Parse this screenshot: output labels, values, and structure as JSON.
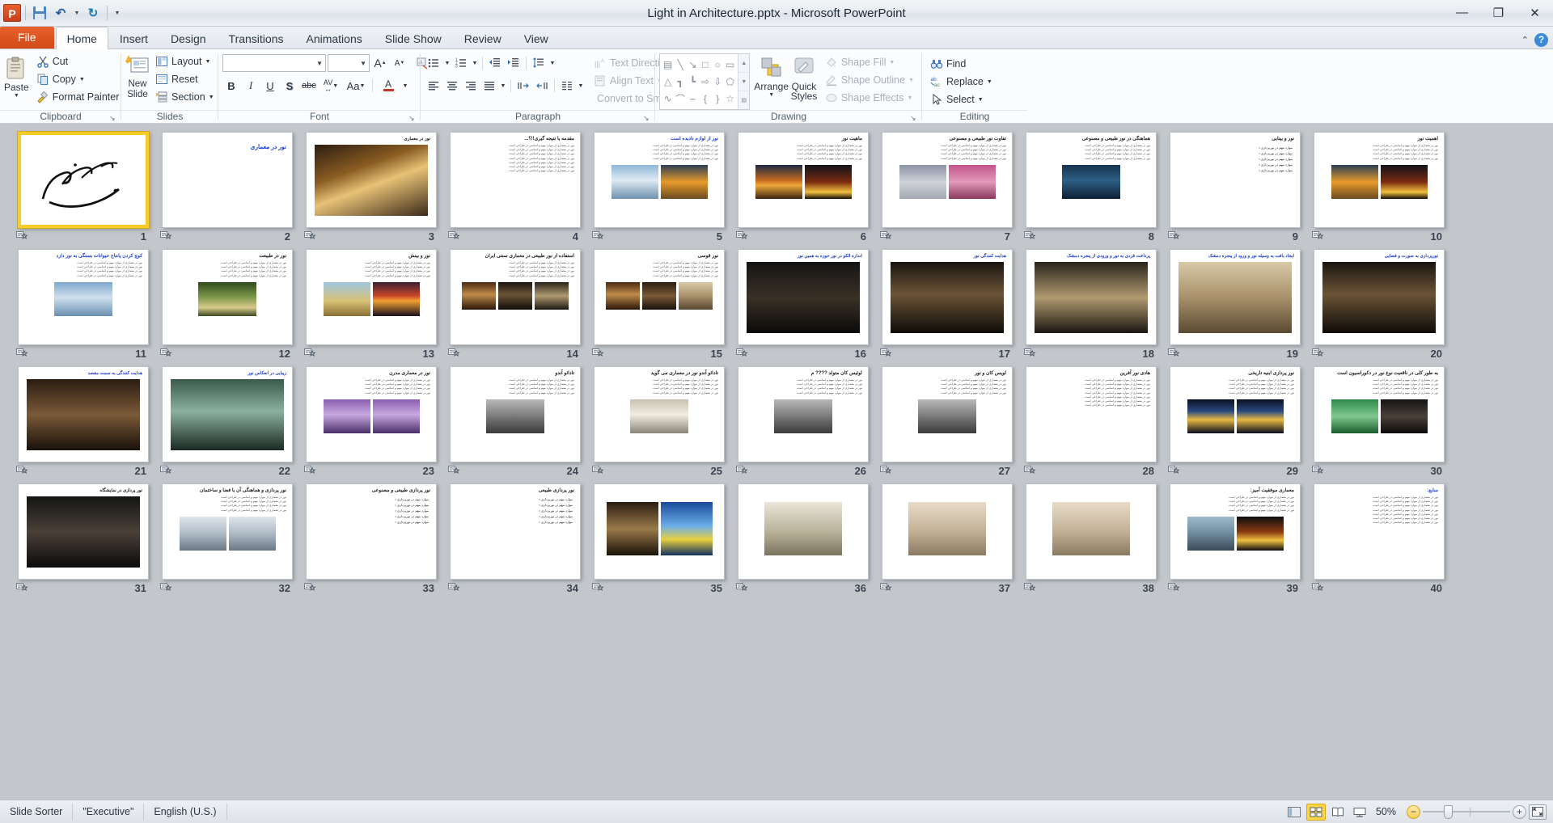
{
  "window": {
    "title": "Light in Architecture.pptx  -  Microsoft PowerPoint",
    "minimize": "—",
    "restore": "❐",
    "close": "✕"
  },
  "qat": {
    "logo": "P",
    "save": "save-icon",
    "undo": "↶",
    "redo": "↻",
    "customize": "≡"
  },
  "tabs": [
    {
      "label": "File",
      "active": false,
      "file": true
    },
    {
      "label": "Home",
      "active": true
    },
    {
      "label": "Insert",
      "active": false
    },
    {
      "label": "Design",
      "active": false
    },
    {
      "label": "Transitions",
      "active": false
    },
    {
      "label": "Animations",
      "active": false
    },
    {
      "label": "Slide Show",
      "active": false
    },
    {
      "label": "Review",
      "active": false
    },
    {
      "label": "View",
      "active": false
    }
  ],
  "help": {
    "minimize_ribbon": "⌃",
    "help": "?"
  },
  "ribbon": {
    "clipboard": {
      "label": "Clipboard",
      "paste": "Paste",
      "cut": "Cut",
      "copy": "Copy",
      "format_painter": "Format Painter",
      "launcher": "↘"
    },
    "slides": {
      "label": "Slides",
      "new_slide": "New\nSlide",
      "new_slide_l1": "New",
      "new_slide_l2": "Slide",
      "layout": "Layout",
      "reset": "Reset",
      "section": "Section"
    },
    "font": {
      "label": "Font",
      "font_name": "",
      "font_size": "",
      "grow": "A",
      "shrink": "A",
      "clear_formatting": "clear-formatting-icon",
      "bold": "B",
      "italic": "I",
      "underline": "U",
      "shadow": "S",
      "strikethrough": "abc",
      "character_spacing": "AV",
      "change_case": "Aa",
      "font_color": "A",
      "launcher": "↘"
    },
    "paragraph": {
      "label": "Paragraph",
      "text_direction": "Text Direction",
      "align_text": "Align Text",
      "convert_to_smartart": "Convert to SmartArt",
      "launcher": "↘"
    },
    "drawing": {
      "label": "Drawing",
      "arrange": "Arrange",
      "quick_styles_l1": "Quick",
      "quick_styles_l2": "Styles",
      "shape_fill": "Shape Fill",
      "shape_outline": "Shape Outline",
      "shape_effects": "Shape Effects",
      "launcher": "↘",
      "shapes": [
        "▤",
        "╲",
        "↘",
        "□",
        "○",
        "▭",
        "△",
        "┓",
        "┗",
        "⇨",
        "⇩",
        "⬠",
        "∿",
        "⌒",
        "⌢",
        "{",
        "}",
        "☆"
      ]
    },
    "editing": {
      "label": "Editing",
      "find": "Find",
      "replace": "Replace",
      "select": "Select"
    }
  },
  "slides": [
    {
      "n": 1,
      "selected": true,
      "type": "calligraphy",
      "title": "",
      "title_color": "black"
    },
    {
      "n": 2,
      "selected": false,
      "type": "title-only",
      "title": "نور در معماری",
      "title_color": "blue"
    },
    {
      "n": 3,
      "selected": false,
      "type": "full-image",
      "title": "نور در معماری",
      "title_color": "white",
      "img": "g-louvre"
    },
    {
      "n": 4,
      "selected": false,
      "type": "text-heavy",
      "title": "مقدمه یا نتیجه گیری!!؟...",
      "title_color": "black"
    },
    {
      "n": 5,
      "selected": false,
      "type": "text-images",
      "title": "نور از لوازم نادیده است",
      "title_color": "blue",
      "imgs": [
        "g-seadawn",
        "g-sunsea"
      ]
    },
    {
      "n": 6,
      "selected": false,
      "type": "text-images",
      "title": "ماهیت نور",
      "title_color": "black",
      "imgs": [
        "g-sunset",
        "g-fire"
      ]
    },
    {
      "n": 7,
      "selected": false,
      "type": "text-images",
      "title": "تفاوت نور طبیعی و مصنوعی",
      "title_color": "black",
      "imgs": [
        "g-mosque",
        "g-pink"
      ]
    },
    {
      "n": 8,
      "selected": false,
      "type": "text-images",
      "title": "هماهنگی در نور طبیعی و مصنوعی",
      "title_color": "black",
      "imgs": [
        "g-bluewater"
      ]
    },
    {
      "n": 9,
      "selected": false,
      "type": "bullets",
      "title": "نور و بینایی",
      "title_color": "black"
    },
    {
      "n": 10,
      "selected": false,
      "type": "text-images",
      "title": "اهمیت نور",
      "title_color": "black",
      "imgs": [
        "g-sunsea",
        "g-fire"
      ]
    },
    {
      "n": 11,
      "selected": false,
      "type": "text-images",
      "title": "کوچ کردن پانتاج حیوانات بستگی به نور دارد",
      "title_color": "blue",
      "imgs": [
        "g-birds"
      ]
    },
    {
      "n": 12,
      "selected": false,
      "type": "text-images",
      "title": "نور در طبیعت",
      "title_color": "black",
      "imgs": [
        "g-forest"
      ]
    },
    {
      "n": 13,
      "selected": false,
      "type": "text-images",
      "title": "نور و بینش",
      "title_color": "black",
      "imgs": [
        "g-pyramid",
        "g-lighthouse"
      ]
    },
    {
      "n": 14,
      "selected": false,
      "type": "text-images",
      "title": "استفاده از نور طبیعی در معماری سنتی ایران",
      "title_color": "black",
      "imgs": [
        "g-vault",
        "g-arch",
        "g-colonnade"
      ]
    },
    {
      "n": 15,
      "selected": false,
      "type": "text-images",
      "title": "نور قوسی",
      "title_color": "black",
      "imgs": [
        "g-vault",
        "g-brick",
        "g-latticed"
      ]
    },
    {
      "n": 16,
      "selected": false,
      "type": "full-image",
      "title": "اندازه الکو در نور حوزه به همین نور",
      "title_color": "blue",
      "img": "g-darkcorr"
    },
    {
      "n": 17,
      "selected": false,
      "type": "full-image",
      "title": "هدایت کنندگی نور",
      "title_color": "blue",
      "img": "g-arch"
    },
    {
      "n": 18,
      "selected": false,
      "type": "full-image",
      "title": "پرداخت فردی به نور و ورودی از پنجره دمشک",
      "title_color": "blue",
      "img": "g-colonnade"
    },
    {
      "n": 19,
      "selected": false,
      "type": "full-image",
      "title": "ایجاد بافت به وسیله نور و ورود از پنجره دمشک",
      "title_color": "blue",
      "img": "g-latticed"
    },
    {
      "n": 20,
      "selected": false,
      "type": "full-image",
      "title": "نورپردازی به صورت و فضایی",
      "title_color": "blue",
      "img": "g-arch"
    },
    {
      "n": 21,
      "selected": false,
      "type": "full-image",
      "title": "هدایت کنندگی به سمت مقصد",
      "title_color": "blue",
      "img": "g-brick"
    },
    {
      "n": 22,
      "selected": false,
      "type": "full-image",
      "title": "زیبایی در انعکاس نور",
      "title_color": "blue",
      "img": "g-mosqueint"
    },
    {
      "n": 23,
      "selected": false,
      "type": "text-images",
      "title": "نور در معماری مدرن",
      "title_color": "black",
      "imgs": [
        "g-bldg",
        "g-bldg"
      ]
    },
    {
      "n": 24,
      "selected": false,
      "type": "text-images",
      "title": "تادائو آندو",
      "title_color": "black",
      "imgs": [
        "g-portrait"
      ]
    },
    {
      "n": 25,
      "selected": false,
      "type": "text-images",
      "title": "تادائو آندو نور در معماری می گوید",
      "title_color": "black",
      "imgs": [
        "g-winlight"
      ]
    },
    {
      "n": 26,
      "selected": false,
      "type": "text-images",
      "title": "لوئیس کان متولد ???? م",
      "title_color": "black",
      "imgs": [
        "g-portrait"
      ]
    },
    {
      "n": 27,
      "selected": false,
      "type": "text-images",
      "title": "لویس کان و نور",
      "title_color": "black",
      "imgs": [
        "g-portrait"
      ]
    },
    {
      "n": 28,
      "selected": false,
      "type": "text-heavy",
      "title": "هادی نور آفرین",
      "title_color": "black"
    },
    {
      "n": 29,
      "selected": false,
      "type": "text-images",
      "title": "نور پردازی ابنیه تاریخی",
      "title_color": "black",
      "imgs": [
        "g-nightmosque",
        "g-nightmosque"
      ]
    },
    {
      "n": 30,
      "selected": false,
      "type": "text-images",
      "title": "به طور کلی در ناقعیت نوع نور در دکوراسیون است",
      "title_color": "black",
      "imgs": [
        "g-green",
        "g-gallery"
      ]
    },
    {
      "n": 31,
      "selected": false,
      "type": "full-image",
      "title": "نور پردازی در نمایشگاه",
      "title_color": "black",
      "img": "g-gallery"
    },
    {
      "n": 32,
      "selected": false,
      "type": "text-images",
      "title": "نور پردازی و هماهنگی آن با فضا و ساختمان",
      "title_color": "black",
      "imgs": [
        "g-office",
        "g-office"
      ]
    },
    {
      "n": 33,
      "selected": false,
      "type": "bullets",
      "title": "نور پردازی طبیعی و مصنوعی",
      "title_color": "black"
    },
    {
      "n": 34,
      "selected": false,
      "type": "bullets",
      "title": "نور پردازی طبیعی",
      "title_color": "black"
    },
    {
      "n": 35,
      "selected": false,
      "type": "images-only",
      "title": "",
      "imgs": [
        "g-conf",
        "g-blueint"
      ]
    },
    {
      "n": 36,
      "selected": false,
      "type": "images-only",
      "title": "",
      "imgs": [
        "g-livingroom"
      ]
    },
    {
      "n": 37,
      "selected": false,
      "type": "images-only",
      "title": "",
      "imgs": [
        "g-beige"
      ]
    },
    {
      "n": 38,
      "selected": false,
      "type": "images-only",
      "title": "",
      "imgs": [
        "g-beige"
      ]
    },
    {
      "n": 39,
      "selected": false,
      "type": "text-images",
      "title": "معماری موفقیت آمیز:",
      "title_color": "black",
      "imgs": [
        "g-aerial",
        "g-firebldg"
      ]
    },
    {
      "n": 40,
      "selected": false,
      "type": "text-heavy",
      "title": "منابع:",
      "title_color": "blue"
    }
  ],
  "statusbar": {
    "view": "Slide Sorter",
    "theme": "\"Executive\"",
    "language": "English (U.S.)",
    "zoom_level": "50%",
    "zoom_out": "−",
    "zoom_in": "+",
    "fit_window": "fit-slide-to-window-icon",
    "views": [
      {
        "name": "normal-view",
        "glyph": "normal",
        "active": false
      },
      {
        "name": "slide-sorter-view",
        "glyph": "sorter",
        "active": true
      },
      {
        "name": "reading-view",
        "glyph": "reading",
        "active": false
      },
      {
        "name": "slide-show-view",
        "glyph": "show",
        "active": false
      }
    ]
  }
}
